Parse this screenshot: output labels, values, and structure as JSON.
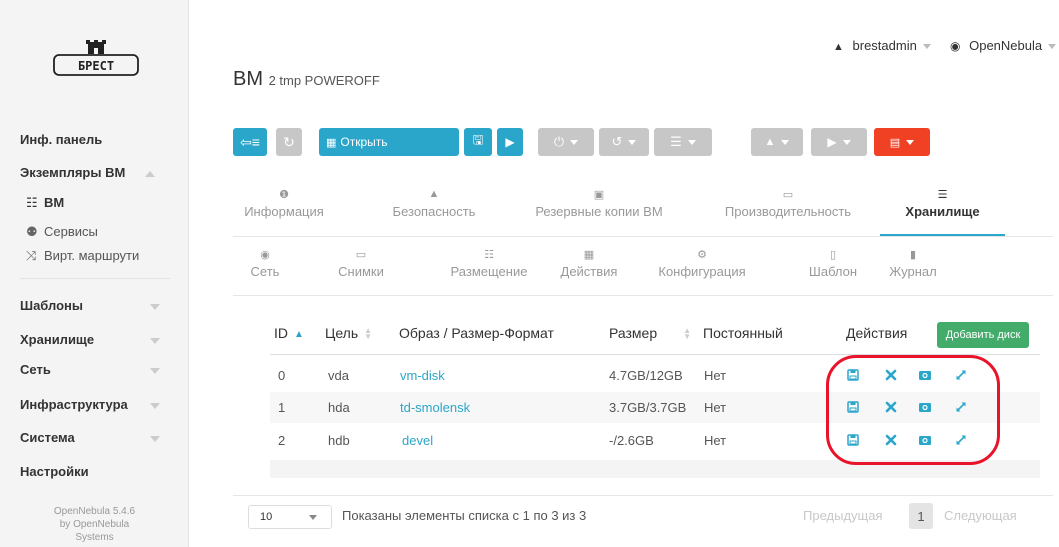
{
  "brand": {
    "logo_text": "БРЕСТ"
  },
  "sidebar": {
    "items": [
      {
        "label": "Инф. панель"
      },
      {
        "label": "Экземпляры ВМ"
      },
      {
        "label": "ВМ"
      },
      {
        "label": "Сервисы"
      },
      {
        "label": "Вирт. маршрути"
      },
      {
        "label": "Шаблоны"
      },
      {
        "label": "Хранилище"
      },
      {
        "label": "Сеть"
      },
      {
        "label": "Инфраструктура"
      },
      {
        "label": "Система"
      },
      {
        "label": "Настройки"
      }
    ],
    "footer": {
      "line1": "OpenNebula 5.4.6",
      "line2": "by OpenNebula",
      "line3": "Systems"
    }
  },
  "topbar": {
    "user": "brestadmin",
    "zone": "OpenNebula"
  },
  "title": {
    "main": "ВМ",
    "sub": "2 tmp POWEROFF"
  },
  "toolbar": {
    "open_label": "Открыть"
  },
  "tabs": {
    "row1": [
      "Информация",
      "Безопасность",
      "Резервные копии ВМ",
      "Производительность",
      "Хранилище"
    ],
    "row2": [
      "Сеть",
      "Снимки",
      "Размещение",
      "Действия",
      "Конфигурация",
      "Шаблон",
      "Журнал"
    ]
  },
  "table": {
    "headers": {
      "id": "ID",
      "target": "Цель",
      "image": "Образ / Размер-Формат",
      "size": "Размер",
      "persistent": "Постоянный",
      "actions": "Действия"
    },
    "add_button": "Добавить диск",
    "rows": [
      {
        "id": "0",
        "target": "vda",
        "image": "vm-disk",
        "size": "4.7GB/12GB",
        "persistent": "Нет"
      },
      {
        "id": "1",
        "target": "hda",
        "image": "td-smolensk",
        "size": "3.7GB/3.7GB",
        "persistent": "Нет"
      },
      {
        "id": "2",
        "target": "hdb",
        "image": "devel",
        "size": "-/2.6GB",
        "persistent": "Нет"
      }
    ]
  },
  "pager": {
    "page_size": "10",
    "info": "Показаны элементы списка с 1 по 3 из 3",
    "prev": "Предыдущая",
    "current": "1",
    "next": "Следующая"
  },
  "colors": {
    "accent": "#2ba6cb",
    "success": "#43ac6a",
    "danger": "#f04124",
    "highlight": "#e8142a"
  }
}
